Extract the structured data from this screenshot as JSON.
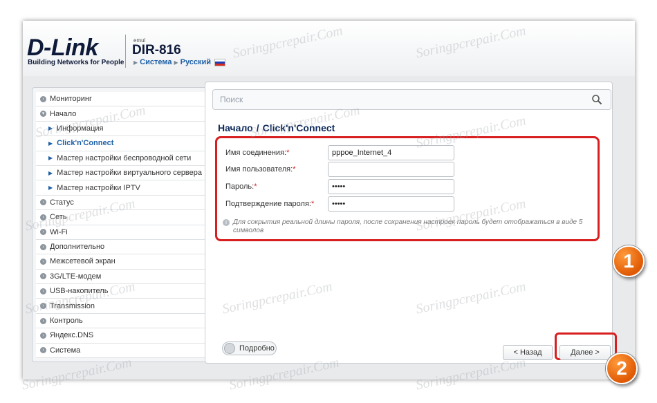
{
  "header": {
    "logo": "D-Link",
    "tagline": "Building Networks for People",
    "emul": "emul",
    "model": "DIR-816",
    "breadcrumb": [
      "Система",
      "Русский"
    ]
  },
  "sidebar": {
    "items": [
      {
        "label": "Мониторинг",
        "type": "top"
      },
      {
        "label": "Начало",
        "type": "top-open"
      },
      {
        "label": "Информация",
        "type": "sub"
      },
      {
        "label": "Click'n'Connect",
        "type": "sub-active"
      },
      {
        "label": "Мастер настройки беспроводной сети",
        "type": "sub"
      },
      {
        "label": "Мастер настройки виртуального сервера",
        "type": "sub"
      },
      {
        "label": "Мастер настройки IPTV",
        "type": "sub"
      },
      {
        "label": "Статус",
        "type": "top"
      },
      {
        "label": "Сеть",
        "type": "top"
      },
      {
        "label": "Wi-Fi",
        "type": "top"
      },
      {
        "label": "Дополнительно",
        "type": "top"
      },
      {
        "label": "Межсетевой экран",
        "type": "top"
      },
      {
        "label": "3G/LTE-модем",
        "type": "top"
      },
      {
        "label": "USB-накопитель",
        "type": "top"
      },
      {
        "label": "Transmission",
        "type": "top"
      },
      {
        "label": "Контроль",
        "type": "top"
      },
      {
        "label": "Яндекс.DNS",
        "type": "top"
      },
      {
        "label": "Система",
        "type": "top"
      }
    ]
  },
  "search": {
    "placeholder": "Поиск"
  },
  "page": {
    "title_part1": "Начало",
    "title_sep": "/",
    "title_part2": "Click'n'Connect"
  },
  "form": {
    "connection_name_label": "Имя соединения:",
    "connection_name_value": "pppoe_Internet_4",
    "username_label": "Имя пользователя:",
    "username_value": "",
    "password_label": "Пароль:",
    "password_value": "•••••",
    "confirm_label": "Подтверждение пароля:",
    "confirm_value": "•••••",
    "required_mark": "*",
    "hint": "Для сокрытия реальной длины пароля, после сохранения настроек пароль будет отображаться в виде 5 символов"
  },
  "controls": {
    "details_label": "Подробно",
    "back_label": "< Назад",
    "next_label": "Далее >"
  },
  "annotations": {
    "badge1": "1",
    "badge2": "2"
  },
  "watermark": "Soringpcrepair.Com",
  "colors": {
    "brand": "#0e1a3a",
    "accent": "#1d5fa6",
    "highlight": "#d81e1e",
    "badge": "#e8650c"
  }
}
